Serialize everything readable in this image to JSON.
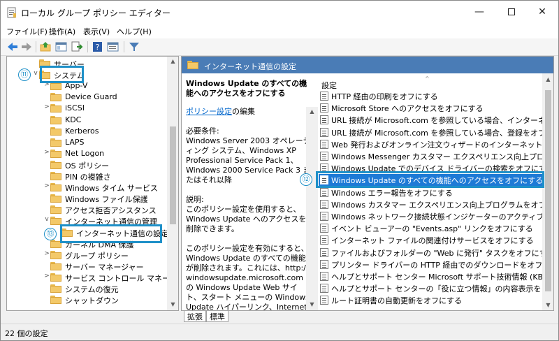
{
  "window": {
    "title": "ローカル グループ ポリシー エディター",
    "minimize_glyph": "—",
    "close_glyph": "✕"
  },
  "menu": [
    {
      "label": "ファイル(F)"
    },
    {
      "label": "操作(A)"
    },
    {
      "label": "表示(V)"
    },
    {
      "label": "ヘルプ(H)"
    }
  ],
  "toolbar": {
    "icons": [
      "back-arrow-icon",
      "forward-arrow-icon",
      "up-folder-icon",
      "show-hide-tree-icon",
      "export-list-icon",
      "help-icon",
      "properties-icon",
      "filter-icon"
    ]
  },
  "tree": {
    "items": [
      {
        "label": "サーバー",
        "expander": ""
      },
      {
        "label": "システム",
        "expander": "v"
      },
      {
        "label": "App-V",
        "expander": ">"
      },
      {
        "label": "Device Guard",
        "expander": ""
      },
      {
        "label": "iSCSI",
        "expander": ">"
      },
      {
        "label": "KDC",
        "expander": ""
      },
      {
        "label": "Kerberos",
        "expander": ""
      },
      {
        "label": "LAPS",
        "expander": ""
      },
      {
        "label": "Net Logon",
        "expander": ">"
      },
      {
        "label": "OS ポリシー",
        "expander": ""
      },
      {
        "label": "PIN の複雑さ",
        "expander": ""
      },
      {
        "label": "Windows タイム サービス",
        "expander": ">"
      },
      {
        "label": "Windows ファイル保護",
        "expander": ""
      },
      {
        "label": "アクセス拒否アシスタンス",
        "expander": ""
      },
      {
        "label": "インターネット通信の管理",
        "expander": "v"
      },
      {
        "label": "インターネット通信の設定",
        "expander": ""
      },
      {
        "label": "カーネル DMA 保護",
        "expander": ""
      },
      {
        "label": "グループ ポリシー",
        "expander": ">"
      },
      {
        "label": "サーバー マネージャー",
        "expander": ""
      },
      {
        "label": "サービス コントロール マネージャーの設",
        "expander": ">"
      },
      {
        "label": "システムの復元",
        "expander": ""
      },
      {
        "label": "シャットダウン",
        "expander": ""
      }
    ]
  },
  "callouts": {
    "c11": "⑪",
    "c12": "⑫",
    "c13": "⑬"
  },
  "right": {
    "header": "インターネット通信の設定",
    "policy_title": "Windows Update のすべての機能へのアクセスをオフにする",
    "edit_link": "ポリシー設定",
    "edit_suffix": "の編集",
    "req_label": "必要条件:",
    "req_text": "Windows Server 2003 オペレーティング システム、Windows XP Professional Service Pack 1、Windows 2000 Service Pack 3 またはそれ以降",
    "desc_label": "説明:",
    "desc_text": "このポリシー設定を使用すると、Windows Update へのアクセスを削除できます。",
    "desc_text2": "このポリシー設定を有効にすると、Windows Update のすべての機能が削除されます。これには、http://windowsupdate.microsoft.com の Windows Update Web サイト、スタート メニューの Windows Update ハイパーリンク、Internet",
    "list_header": "設定",
    "settings": [
      "HTTP 経由の印刷をオフにする",
      "Microsoft Store へのアクセスをオフにする",
      "URL 接続が Microsoft.com を参照している場合、インターネット接...",
      "URL 接続が Microsoft.com を参照している場合、登録をオフにする",
      "Web 発行およびオンライン注文ウィザードのインターネット ダウンロードを...",
      "Windows Messenger カスタマー エクスペリエンス向上プログラムをオ...",
      "Windows Update でのデバイス ドライバーの検索をオフにする",
      "Windows Update のすべての機能へのアクセスをオフにする",
      "Windows エラー報告をオフにする",
      "Windows カスタマー エクスペリエンス向上プログラムをオフにする",
      "Windows ネットワーク接続状態インジケーターのアクティブなテストを無...",
      "イベント ビューアーの \"Events.asp\" リンクをオフにする",
      "インターネット ファイルの関連付けサービスをオフにする",
      "ファイルおよびフォルダーの \"Web に発行\" タスクをオフにする",
      "プリンター ドライバーの HTTP 経由でのダウンロードをオフにする",
      "ヘルプとサポート センター Microsoft サポート技術情報 (KB) の検索を...",
      "ヘルプとサポート センターの「役に立つ情報」の内容表示をしない",
      "ルート証明書の自動更新をオフにする"
    ],
    "selected_index": 7
  },
  "tabs": [
    {
      "label": "拡張"
    },
    {
      "label": "標準"
    }
  ],
  "status": "22 個の設定",
  "colors": {
    "highlight_border": "#1e90c8",
    "selection": "#1e7ad6",
    "header_bg": "#4a7cb6"
  }
}
